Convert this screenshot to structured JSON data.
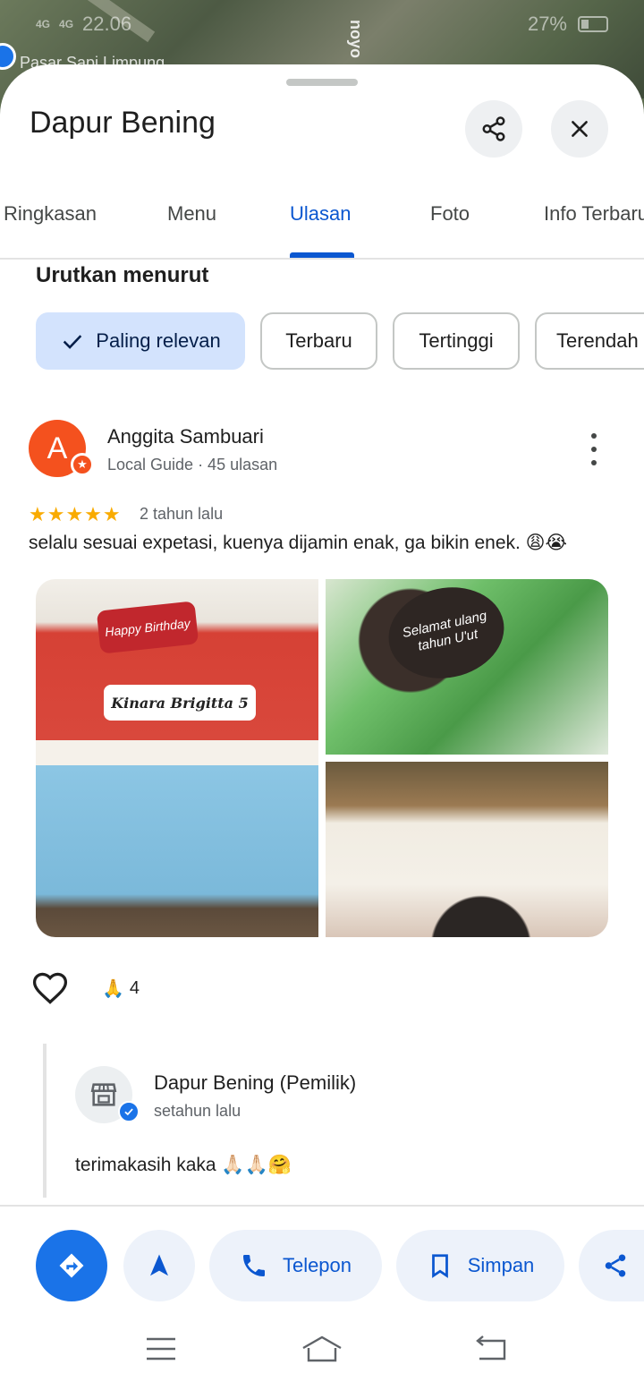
{
  "status_bar": {
    "time": "22.06",
    "network_left": "4G",
    "network_right": "4G",
    "battery": "27%"
  },
  "map": {
    "label": "Pasar Sapi Limpung",
    "road_label": "noyo"
  },
  "place": {
    "title": "Dapur Bening"
  },
  "tabs": [
    {
      "label": "Ringkasan"
    },
    {
      "label": "Menu"
    },
    {
      "label": "Ulasan"
    },
    {
      "label": "Foto"
    },
    {
      "label": "Info Terbaru"
    }
  ],
  "sort": {
    "label": "Urutkan menurut",
    "chips": [
      {
        "label": "Paling relevan",
        "selected": true
      },
      {
        "label": "Terbaru"
      },
      {
        "label": "Tertinggi"
      },
      {
        "label": "Terendah"
      }
    ]
  },
  "review": {
    "avatar_letter": "A",
    "name": "Anggita Sambuari",
    "meta": "Local Guide · 45 ulasan",
    "rating": 5,
    "stars_text": "★★★★★",
    "time": "2 tahun lalu",
    "text": "selalu sesuai expetasi, kuenya dijamin enak, ga bikin enek. 😩😭",
    "photo_texts": {
      "topper": "Happy Birthday",
      "label": "Kinara Brigitta 5",
      "plaque": "Selamat ulang tahun U'ut"
    },
    "reaction_emoji": "🙏",
    "reaction_count": "4"
  },
  "owner_reply": {
    "name": "Dapur Bening (Pemilik)",
    "time": "setahun lalu",
    "text": "terimakasih kaka 🙏🏻🙏🏻🤗"
  },
  "actions": {
    "call": "Telepon",
    "save": "Simpan"
  },
  "colors": {
    "accent": "#0b57d0",
    "primary_fab": "#1a73e8",
    "star": "#f9ab00",
    "avatar": "#f4511e"
  }
}
